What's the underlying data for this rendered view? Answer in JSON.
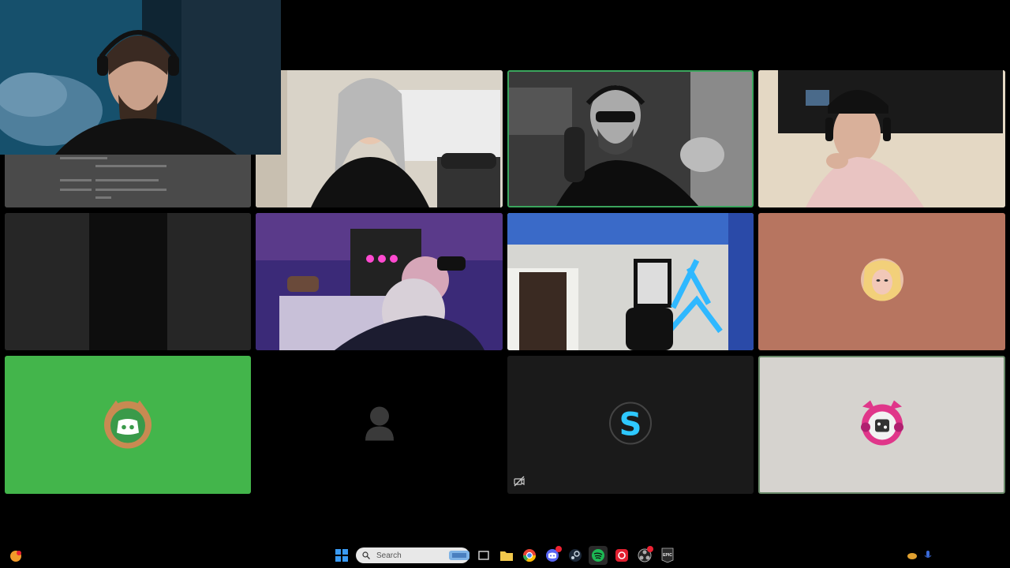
{
  "taskbar": {
    "search_placeholder": "Search",
    "apps": [
      {
        "name": "start-button"
      },
      {
        "name": "task-view"
      },
      {
        "name": "file-explorer"
      },
      {
        "name": "chrome"
      },
      {
        "name": "discord"
      },
      {
        "name": "steam"
      },
      {
        "name": "spotify"
      },
      {
        "name": "red-app"
      },
      {
        "name": "obs"
      },
      {
        "name": "epic-games"
      }
    ],
    "epic_label": "EPIC"
  },
  "colors": {
    "speaking_border": "#3ba55d",
    "discord_green": "#43b54b",
    "discord_blurple": "#5865f2",
    "avatar_tile_salmon": "#b77560",
    "avatar_tile_light": "#d6d3cf"
  },
  "icons": {
    "camera_off": "camera-off-icon",
    "default_avatar": "user-silhouette-icon"
  },
  "avatars": {
    "t11_letter": "S"
  }
}
